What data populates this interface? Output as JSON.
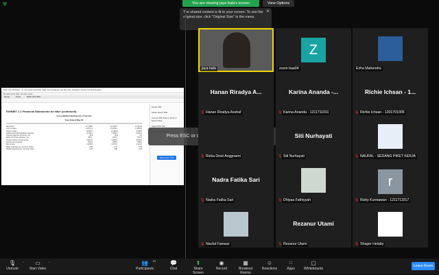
{
  "banner": {
    "viewing": "You are viewing jaya bala's screen",
    "view_options": "View Options"
  },
  "tooltip": {
    "text": "The shared content is fit to your screen. To see the original size, click \"Original Size\" in the menu."
  },
  "esc_banner": "Press ESC or double-click to exit full screen mode",
  "shared_doc": {
    "window_title": "1601-US-CRSlides - S. Principal Financial Statement Analysis and Security Valuation Adobe Acrobat Reader",
    "menu": "File  Edit  View  Sign  Window  Help",
    "tabs": [
      "Home",
      "Tools",
      "1601-US-CRSl..."
    ],
    "exhibit": "EXHIBIT 2.1  Financial Statements for Nike (continued)",
    "statement_title": "Consolidated Statements of Income",
    "year_header": "Year Ended May 31",
    "rows": [
      [
        "Revenues",
        "27,799.0",
        "24,128.1",
        "21,214.9"
      ],
      [
        "Cost of sales",
        "14,973.4",
        "13,183.1",
        "11,875.9"
      ],
      [
        "Gross margin",
        "12,825.6",
        "10,945.0",
        "9,339.0"
      ],
      [
        "Selling and administrative expense",
        "8,766.2",
        "7,405.6",
        "6,569.3"
      ],
      [
        "Interest expense (income), net",
        "33.0",
        "(3.0)",
        "3.0"
      ],
      [
        "Other (income) expense, net",
        "58.0",
        "(15.0)",
        "(54.0)"
      ],
      [
        "Income before income taxes",
        "3,544.0",
        "3,256.0",
        "2,563.0"
      ],
      [
        "Income tax expense",
        "851.0",
        "805.0",
        "555.0"
      ],
      [
        "Net income",
        "2,693.0",
        "2,472.0",
        "2,211.0"
      ],
      [
        "Basic earnings per common share",
        "3.05",
        "2.74",
        "2.39"
      ],
      [
        "Diluted earnings per common share",
        "2.97",
        "2.68",
        "2.34"
      ]
    ],
    "side_items": [
      "Export PDF",
      "Adobe Export PDF",
      "Convert PDF Files to Word or Excel Online",
      "Select PDF File",
      "Document Language"
    ],
    "side_cta": "Start Free Trial"
  },
  "participants": [
    {
      "name": "jaya bala",
      "display": "",
      "type": "video",
      "active": true
    },
    {
      "name": "zoom baa04",
      "display": "Z",
      "type": "letter",
      "color": "#1aa3a3"
    },
    {
      "name": "Ezha Mahendra",
      "display": "",
      "type": "photo",
      "color": "#2a5d9a"
    },
    {
      "name": "Hanan Riradya Asshaf",
      "display": "Hanan Riradya A...",
      "type": "text",
      "muted": true
    },
    {
      "name": "Karina Ananda - 1211711011",
      "display": "Karina Ananda -...",
      "type": "text",
      "muted": true
    },
    {
      "name": "Richie Ichsan - 1201701006",
      "display": "Richie Ichsan - 1...",
      "type": "text",
      "muted": true
    },
    {
      "name": "Rizka Dewi Anggraeni",
      "display": "",
      "type": "blank",
      "muted": true
    },
    {
      "name": "Siti Nurhayati",
      "display": "Siti Nurhayati",
      "type": "text",
      "muted": true
    },
    {
      "name": "NAUFAL - SEDANG PIKET KERJA",
      "display": "",
      "type": "photo",
      "color": "#e8eef7",
      "muted": true
    },
    {
      "name": "Nadra Fatika Sari",
      "display": "Nadra Fatika Sari",
      "type": "text",
      "muted": true
    },
    {
      "name": "Dhiyaa Fathiyyah",
      "display": "",
      "type": "photo",
      "color": "#cfd8cf",
      "muted": true
    },
    {
      "name": "Rizky Kurniawan - 1211711017",
      "display": "r",
      "type": "letter",
      "color": "#8a96a0",
      "muted": true
    },
    {
      "name": "Naufal Faewaz",
      "display": "",
      "type": "photo",
      "color": "#b8c7cf",
      "muted": true
    },
    {
      "name": "Rezanur Utami",
      "display": "Rezanur Utami",
      "type": "text",
      "muted": true
    },
    {
      "name": "Shager Helaby",
      "display": "",
      "type": "photo",
      "color": "#ffffff",
      "muted": true
    }
  ],
  "toolbar": {
    "unmute": "Unmute",
    "start_video": "Start Video",
    "participants": "Participants",
    "participants_count": "15",
    "chat": "Chat",
    "share_screen": "Share Screen",
    "record": "Record",
    "breakout": "Breakout Rooms",
    "reactions": "Reactions",
    "apps": "Apps",
    "whiteboards": "Whiteboards",
    "leave": "Leave Room"
  },
  "colors": {
    "accent": "#2d8cff",
    "share": "#34c759",
    "active_border": "#f2d600",
    "badge": "#23a24d"
  }
}
